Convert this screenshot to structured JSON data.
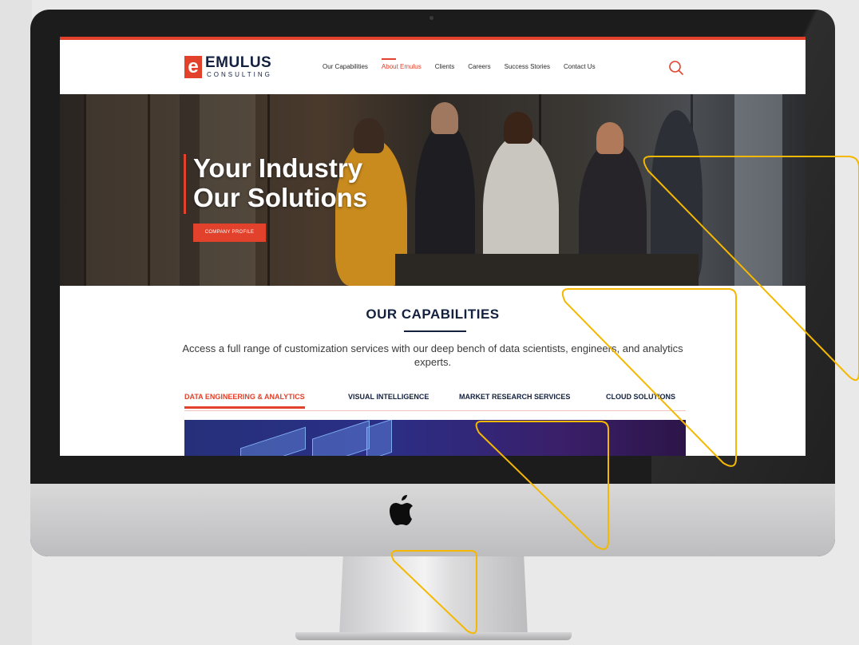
{
  "brand": {
    "logo_mark": "e",
    "logo_word": "EMULUS",
    "logo_sub": "CONSULTING",
    "accent_color": "#e2412b",
    "navy_color": "#13213f"
  },
  "nav": {
    "items": [
      {
        "label": "Our Capabilities",
        "active": false
      },
      {
        "label": "About Emulus",
        "active": true
      },
      {
        "label": "Clients",
        "active": false
      },
      {
        "label": "Careers",
        "active": false
      },
      {
        "label": "Success Stories",
        "active": false
      },
      {
        "label": "Contact Us",
        "active": false
      }
    ],
    "search_icon": "search-icon"
  },
  "hero": {
    "title_line1": "Your Industry",
    "title_line2": "Our Solutions",
    "button_label": "COMPANY PROFILE"
  },
  "capabilities": {
    "title": "OUR CAPABILITIES",
    "description": "Access a full range of customization services with our deep bench of data scientists, engineers, and analytics experts.",
    "tabs": [
      {
        "label": "DATA ENGINEERING & ANALYTICS",
        "active": true
      },
      {
        "label": "VISUAL INTELLIGENCE",
        "active": false
      },
      {
        "label": "MARKET RESEARCH SERVICES",
        "active": false
      },
      {
        "label": "CLOUD SOLUTIONS",
        "active": false
      }
    ]
  },
  "device": {
    "logo_icon": "apple-logo-icon",
    "overlay_color": "#f5b800"
  }
}
